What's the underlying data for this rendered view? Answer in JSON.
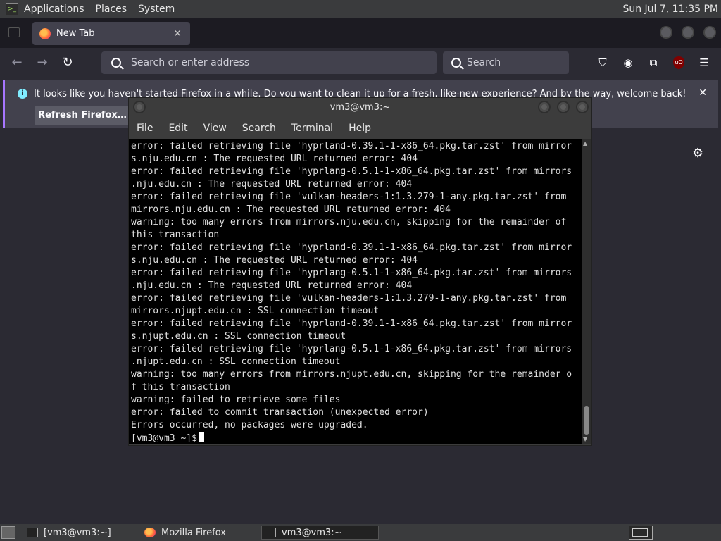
{
  "top_panel": {
    "menus": [
      "Applications",
      "Places",
      "System"
    ],
    "clock": "Sun Jul  7, 11:35 PM"
  },
  "firefox": {
    "tab_title": "New Tab",
    "url_placeholder": "Search or enter address",
    "search_placeholder": "Search",
    "notification": {
      "message": "It looks like you haven't started Firefox in a while. Do you want to clean it up for a fresh, like-new experience? And by the way, welcome back!",
      "button": "Refresh Firefox…"
    }
  },
  "terminal": {
    "title": "vm3@vm3:~",
    "menu": [
      "File",
      "Edit",
      "View",
      "Search",
      "Terminal",
      "Help"
    ],
    "lines": [
      "error: failed retrieving file 'hyprland-0.39.1-1-x86_64.pkg.tar.zst' from mirror",
      "s.nju.edu.cn : The requested URL returned error: 404",
      "error: failed retrieving file 'hyprlang-0.5.1-1-x86_64.pkg.tar.zst' from mirrors",
      ".nju.edu.cn : The requested URL returned error: 404",
      "error: failed retrieving file 'vulkan-headers-1:1.3.279-1-any.pkg.tar.zst' from",
      "mirrors.nju.edu.cn : The requested URL returned error: 404",
      "warning: too many errors from mirrors.nju.edu.cn, skipping for the remainder of",
      "this transaction",
      "error: failed retrieving file 'hyprland-0.39.1-1-x86_64.pkg.tar.zst' from mirror",
      "s.nju.edu.cn : The requested URL returned error: 404",
      "error: failed retrieving file 'hyprlang-0.5.1-1-x86_64.pkg.tar.zst' from mirrors",
      ".nju.edu.cn : The requested URL returned error: 404",
      "error: failed retrieving file 'vulkan-headers-1:1.3.279-1-any.pkg.tar.zst' from",
      "mirrors.njupt.edu.cn : SSL connection timeout",
      "error: failed retrieving file 'hyprland-0.39.1-1-x86_64.pkg.tar.zst' from mirror",
      "s.njupt.edu.cn : SSL connection timeout",
      "error: failed retrieving file 'hyprlang-0.5.1-1-x86_64.pkg.tar.zst' from mirrors",
      ".njupt.edu.cn : SSL connection timeout",
      "warning: too many errors from mirrors.njupt.edu.cn, skipping for the remainder o",
      "f this transaction",
      "warning: failed to retrieve some files",
      "error: failed to commit transaction (unexpected error)",
      "Errors occurred, no packages were upgraded."
    ],
    "prompt": "[vm3@vm3 ~]$"
  },
  "taskbar": {
    "items": [
      "[vm3@vm3:~]",
      "Mozilla Firefox",
      "vm3@vm3:~"
    ]
  },
  "colors": {
    "firefox_bg": "#2b2a33",
    "notification_accent": "#a776ff",
    "terminal_bg": "#000000"
  }
}
